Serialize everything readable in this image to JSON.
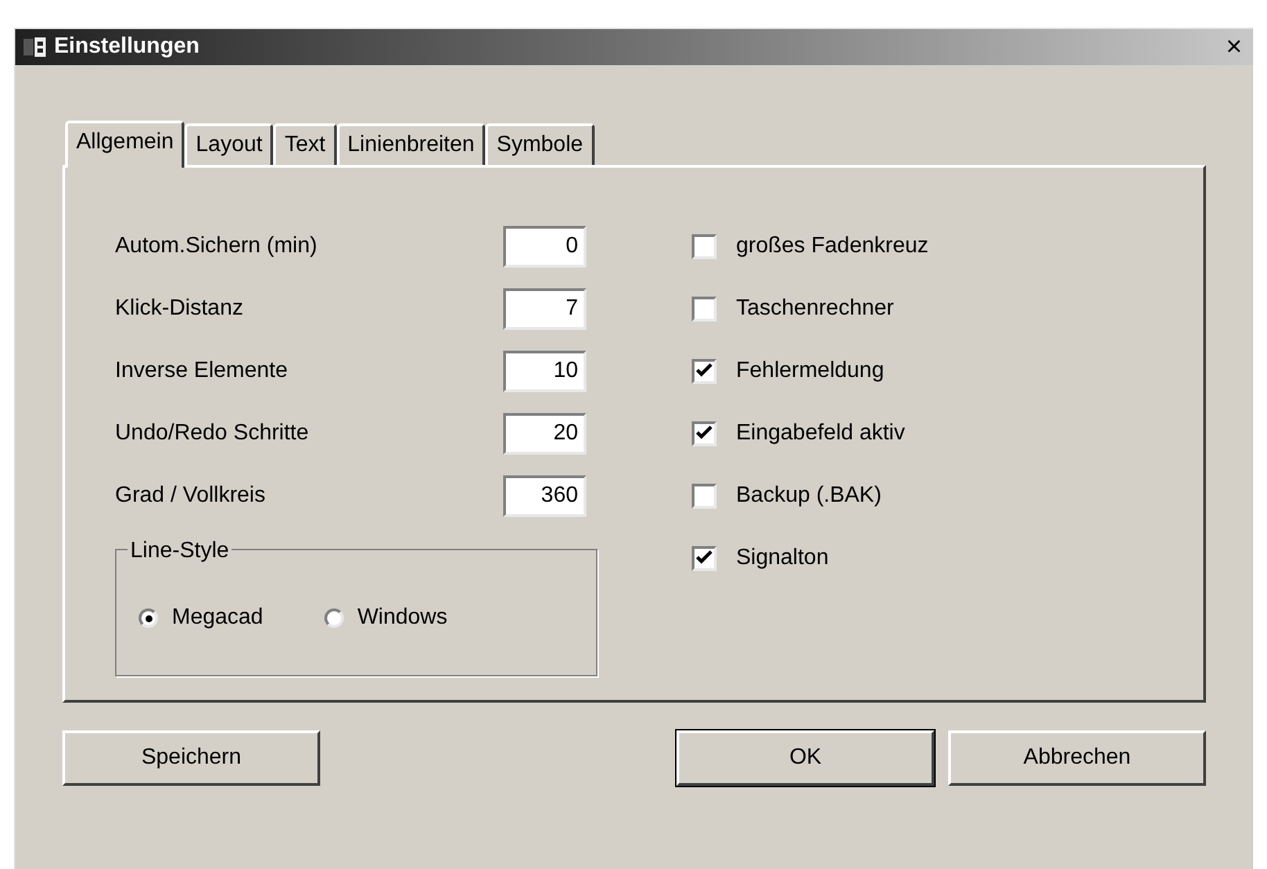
{
  "window": {
    "title": "Einstellungen",
    "close": "×"
  },
  "tabs": [
    {
      "label": "Allgemein",
      "selected": true
    },
    {
      "label": "Layout",
      "selected": false
    },
    {
      "label": "Text",
      "selected": false
    },
    {
      "label": "Linienbreiten",
      "selected": false
    },
    {
      "label": "Symbole",
      "selected": false
    }
  ],
  "fields": [
    {
      "label": "Autom.Sichern (min)",
      "value": "0"
    },
    {
      "label": "Klick-Distanz",
      "value": "7"
    },
    {
      "label": "Inverse Elemente",
      "value": "10"
    },
    {
      "label": "Undo/Redo Schritte",
      "value": "20"
    },
    {
      "label": "Grad / Vollkreis",
      "value": "360"
    }
  ],
  "line_style": {
    "title": "Line-Style",
    "options": [
      {
        "label": "Megacad",
        "selected": true
      },
      {
        "label": "Windows",
        "selected": false
      }
    ]
  },
  "checkboxes": [
    {
      "label": "großes Fadenkreuz",
      "checked": false
    },
    {
      "label": "Taschenrechner",
      "checked": false
    },
    {
      "label": "Fehlermeldung",
      "checked": true
    },
    {
      "label": "Eingabefeld aktiv",
      "checked": true
    },
    {
      "label": "Backup (.BAK)",
      "checked": false
    },
    {
      "label": "Signalton",
      "checked": true
    }
  ],
  "buttons": [
    {
      "label": "Speichern",
      "kind": "left"
    },
    {
      "label": "OK",
      "kind": "default"
    },
    {
      "label": "Abbrechen",
      "kind": "right"
    }
  ]
}
